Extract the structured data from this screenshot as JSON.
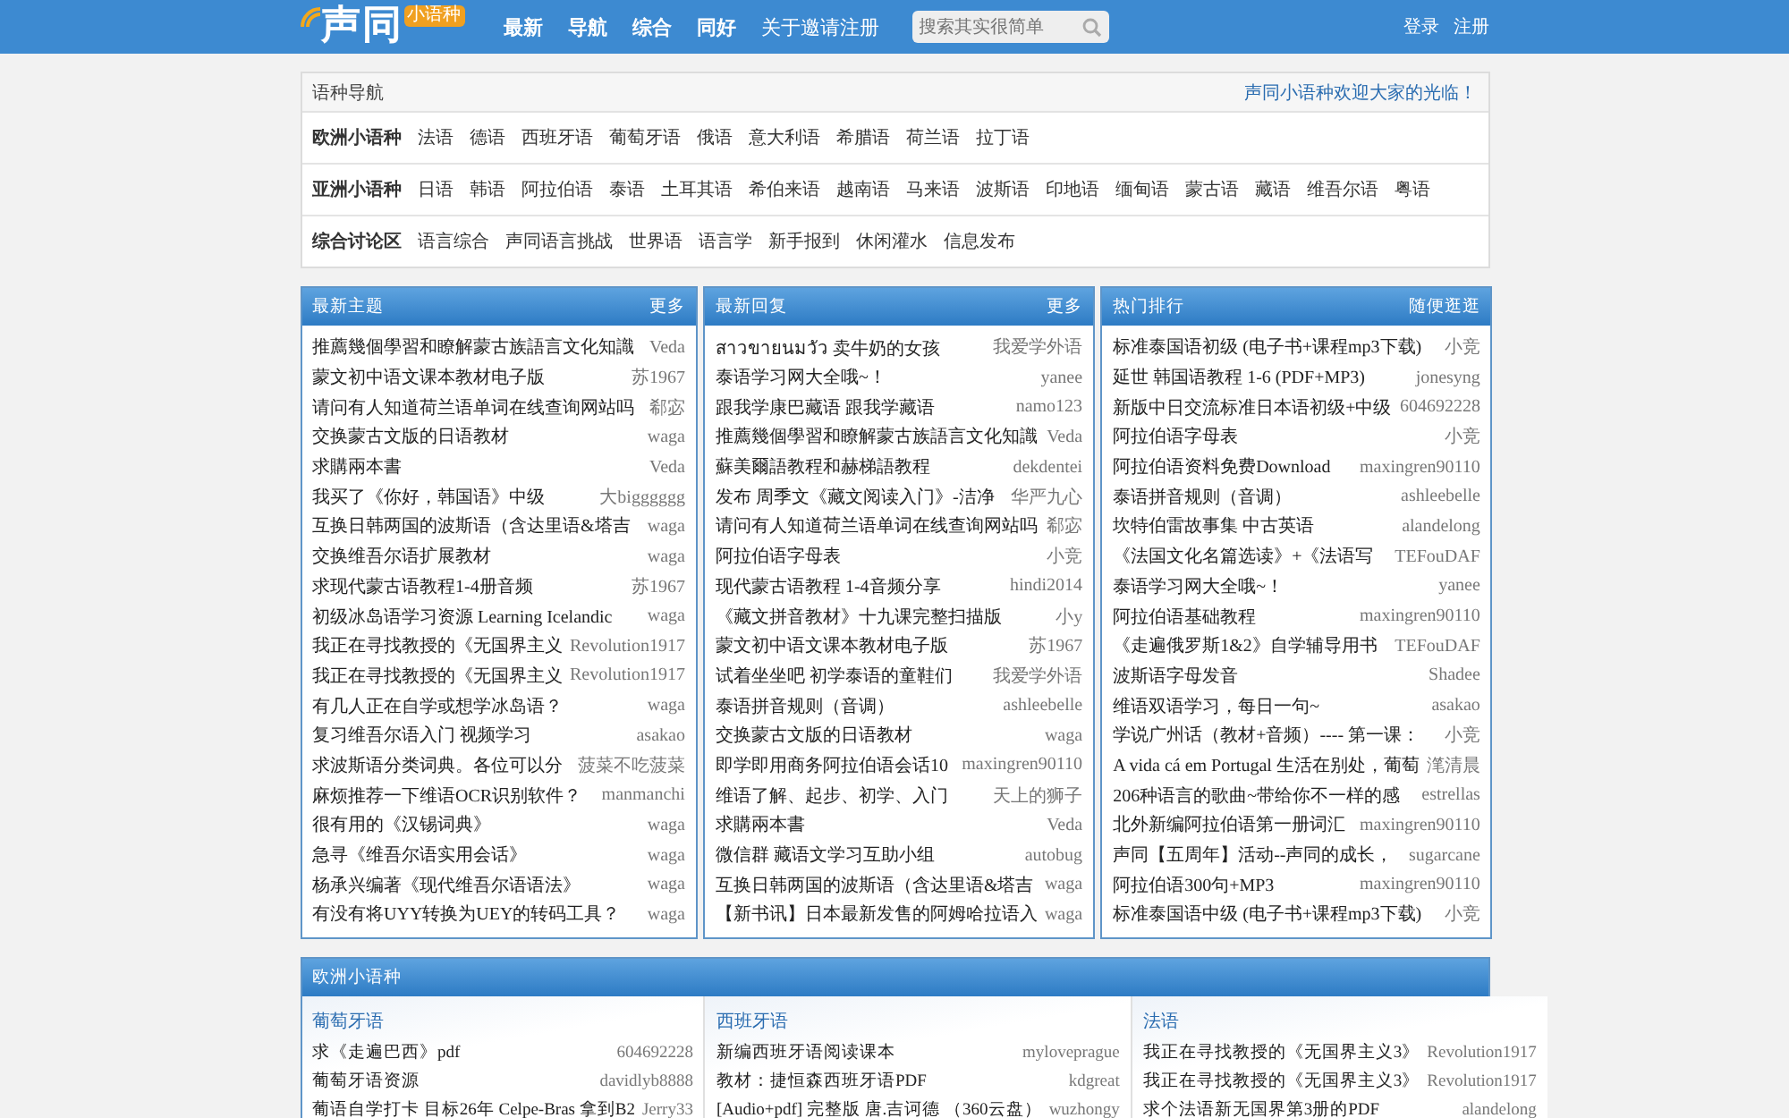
{
  "header": {
    "logo": {
      "text": "声同",
      "badge": "小语种"
    },
    "nav": [
      "最新",
      "导航",
      "综合",
      "同好",
      "关于邀请注册"
    ],
    "search": {
      "placeholder": "搜索其实很简单"
    },
    "auth": [
      "登录",
      "注册"
    ]
  },
  "language_nav": {
    "title": "语种导航",
    "welcome": "声同小语种欢迎大家的光临！",
    "groups": [
      {
        "heading": "欧洲小语种",
        "links": [
          "法语",
          "德语",
          "西班牙语",
          "葡萄牙语",
          "俄语",
          "意大利语",
          "希腊语",
          "荷兰语",
          "拉丁语"
        ]
      },
      {
        "heading": "亚洲小语种",
        "links": [
          "日语",
          "韩语",
          "阿拉伯语",
          "泰语",
          "土耳其语",
          "希伯来语",
          "越南语",
          "马来语",
          "波斯语",
          "印地语",
          "缅甸语",
          "蒙古语",
          "藏语",
          "维吾尔语",
          "粤语"
        ]
      },
      {
        "heading": "综合讨论区",
        "links": [
          "语言综合",
          "声同语言挑战",
          "世界语",
          "语言学",
          "新手报到",
          "休闲灌水",
          "信息发布"
        ]
      }
    ]
  },
  "panels": [
    {
      "title": "最新主题",
      "more": "更多",
      "rows": [
        {
          "title": "推薦幾個學習和瞭解蒙古族語言文化知識",
          "author": "Veda"
        },
        {
          "title": "蒙文初中语文课本教材电子版",
          "author": "苏1967"
        },
        {
          "title": "请问有人知道荷兰语单词在线查询网站吗",
          "author": "郗宓"
        },
        {
          "title": "交换蒙古文版的日语教材",
          "author": "waga"
        },
        {
          "title": "求購兩本書",
          "author": "Veda"
        },
        {
          "title": "我买了《你好，韩国语》中级",
          "author": "大bigggggg"
        },
        {
          "title": "互换日韩两国的波斯语（含达里语&塔吉",
          "author": "waga"
        },
        {
          "title": "交换维吾尔语扩展教材",
          "author": "waga"
        },
        {
          "title": "求现代蒙古语教程1-4册音频",
          "author": "苏1967"
        },
        {
          "title": "初级冰岛语学习资源 Learning Icelandic",
          "author": "waga"
        },
        {
          "title": "我正在寻找教授的《无国界主义",
          "author": "Revolution1917"
        },
        {
          "title": "我正在寻找教授的《无国界主义",
          "author": "Revolution1917"
        },
        {
          "title": "有几人正在自学或想学冰岛语？",
          "author": "waga"
        },
        {
          "title": "复习维吾尔语入门 视频学习",
          "author": "asakao"
        },
        {
          "title": "求波斯语分类词典。各位可以分",
          "author": "菠菜不吃菠菜"
        },
        {
          "title": "麻烦推荐一下维语OCR识别软件？",
          "author": "manmanchi"
        },
        {
          "title": "很有用的《汉锡词典》",
          "author": "waga"
        },
        {
          "title": "急寻《维吾尔语实用会话》",
          "author": "waga"
        },
        {
          "title": "杨承兴编著《现代维吾尔语语法》",
          "author": "waga"
        },
        {
          "title": "有没有将UYY转换为UEY的转码工具？",
          "author": "waga"
        }
      ]
    },
    {
      "title": "最新回复",
      "more": "更多",
      "rows": [
        {
          "title": "สาวขายนมวัว 卖牛奶的女孩",
          "author": "我爱学外语"
        },
        {
          "title": "泰语学习网大全哦~！",
          "author": "yanee"
        },
        {
          "title": "跟我学康巴藏语 跟我学藏语",
          "author": "namo123"
        },
        {
          "title": "推薦幾個學習和瞭解蒙古族語言文化知識",
          "author": "Veda"
        },
        {
          "title": "蘇美爾語教程和赫梯語教程",
          "author": "dekdentei"
        },
        {
          "title": "发布 周季文《藏文阅读入门》-洁净",
          "author": "华严九心"
        },
        {
          "title": "请问有人知道荷兰语单词在线查询网站吗",
          "author": "郗宓"
        },
        {
          "title": "阿拉伯语字母表",
          "author": "小竞"
        },
        {
          "title": "现代蒙古语教程 1-4音频分享",
          "author": "hindi2014"
        },
        {
          "title": "《藏文拼音教材》十九课完整扫描版",
          "author": "小y"
        },
        {
          "title": "蒙文初中语文课本教材电子版",
          "author": "苏1967"
        },
        {
          "title": "试着坐坐吧 初学泰语的童鞋们",
          "author": "我爱学外语"
        },
        {
          "title": "泰语拼音规则（音调）",
          "author": "ashleebelle"
        },
        {
          "title": "交换蒙古文版的日语教材",
          "author": "waga"
        },
        {
          "title": "即学即用商务阿拉伯语会话10",
          "author": "maxingren90110"
        },
        {
          "title": "维语了解、起步、初学、入门",
          "author": "天上的狮子"
        },
        {
          "title": "求購兩本書",
          "author": "Veda"
        },
        {
          "title": "微信群 藏语文学习互助小组",
          "author": "autobug"
        },
        {
          "title": "互换日韩两国的波斯语（含达里语&塔吉",
          "author": "waga"
        },
        {
          "title": "【新书讯】日本最新发售的阿姆哈拉语入",
          "author": "waga"
        }
      ]
    },
    {
      "title": "热门排行",
      "more": "随便逛逛",
      "rows": [
        {
          "title": "标准泰国语初级 (电子书+课程mp3下载)",
          "author": "小竞"
        },
        {
          "title": "延世 韩国语教程 1-6 (PDF+MP3)",
          "author": "jonesyng"
        },
        {
          "title": "新版中日交流标准日本语初级+中级",
          "author": "604692228"
        },
        {
          "title": "阿拉伯语字母表",
          "author": "小竞"
        },
        {
          "title": "阿拉伯语资料免费Download",
          "author": "maxingren90110"
        },
        {
          "title": "泰语拼音规则（音调）",
          "author": "ashleebelle"
        },
        {
          "title": "坎特伯雷故事集 中古英语",
          "author": "alandelong"
        },
        {
          "title": "《法国文化名篇选读》+《法语写",
          "author": "TEFouDAF"
        },
        {
          "title": "泰语学习网大全哦~！",
          "author": "yanee"
        },
        {
          "title": "阿拉伯语基础教程",
          "author": "maxingren90110"
        },
        {
          "title": "《走遍俄罗斯1&2》自学辅导用书",
          "author": "TEFouDAF"
        },
        {
          "title": "波斯语字母发音",
          "author": "Shadee"
        },
        {
          "title": "维语双语学习，每日一句~",
          "author": "asakao"
        },
        {
          "title": "学说广州话（教材+音频）---- 第一课：",
          "author": "小竞"
        },
        {
          "title": "A vida cá em Portugal 生活在别处，葡萄",
          "author": "滗清晨"
        },
        {
          "title": "206种语言的歌曲~带给你不一样的感",
          "author": "estrellas"
        },
        {
          "title": "北外新编阿拉伯语第一册词汇",
          "author": "maxingren90110"
        },
        {
          "title": "声同【五周年】活动--声同的成长，",
          "author": "sugarcane"
        },
        {
          "title": "阿拉伯语300句+MP3",
          "author": "maxingren90110"
        },
        {
          "title": "标准泰国语中级 (电子书+课程mp3下载)",
          "author": "小竞"
        }
      ]
    }
  ],
  "europe_section": {
    "title": "欧洲小语种",
    "columns": [
      {
        "title": "葡萄牙语",
        "rows": [
          {
            "title": "求《走遍巴西》pdf",
            "author": "604692228"
          },
          {
            "title": "葡萄牙语资源",
            "author": "davidlyb8888"
          },
          {
            "title": "葡语自学打卡 目标26年 Celpe-Bras 拿到B2",
            "author": "Jerry33"
          }
        ]
      },
      {
        "title": "西班牙语",
        "rows": [
          {
            "title": "新编西班牙语阅读课本",
            "author": "myloveprague"
          },
          {
            "title": "教材：捷恒森西班牙语PDF",
            "author": "kdgreat"
          },
          {
            "title": "[Audio+pdf] 完整版 唐.吉诃德 （360云盘）",
            "author": "wuzhongy"
          }
        ]
      },
      {
        "title": "法语",
        "rows": [
          {
            "title": "我正在寻找教授的《无国界主义3》",
            "author": "Revolution1917"
          },
          {
            "title": "我正在寻找教授的《无国界主义3》",
            "author": "Revolution1917"
          },
          {
            "title": "求个法语新无国界第3册的PDF",
            "author": "alandelong"
          }
        ]
      }
    ]
  }
}
